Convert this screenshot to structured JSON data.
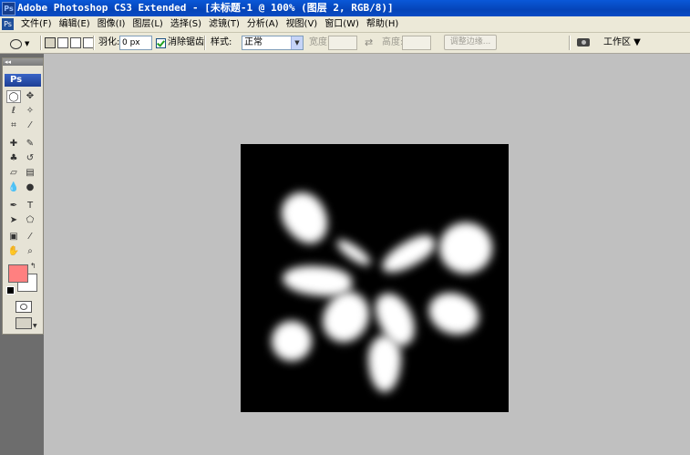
{
  "titlebar": {
    "app_icon": "Ps",
    "title": "Adobe Photoshop CS3 Extended - [未标题-1 @ 100% (图层 2, RGB/8)]"
  },
  "menubar": {
    "doc_icon": "Ps",
    "items": [
      "文件(F)",
      "编辑(E)",
      "图像(I)",
      "图层(L)",
      "选择(S)",
      "滤镜(T)",
      "分析(A)",
      "视图(V)",
      "窗口(W)",
      "帮助(H)"
    ]
  },
  "options": {
    "feather_label": "羽化:",
    "feather_value": "0 px",
    "antialias_label": "消除锯齿",
    "style_label": "样式:",
    "style_value": "正常",
    "width_label": "宽度:",
    "height_label": "高度:",
    "refine_edge_label": "调整边缘...",
    "workspace_label": "工作区 ▼",
    "swap_icon": "⇄"
  },
  "toolbox": {
    "collapse_label": "◂◂",
    "logo": "Ps",
    "swap_colors": "↰",
    "fg_color": "#ff8080",
    "bg_color": "#ffffff"
  },
  "canvas": {
    "background": "#000000",
    "content": "blurred white petals"
  }
}
